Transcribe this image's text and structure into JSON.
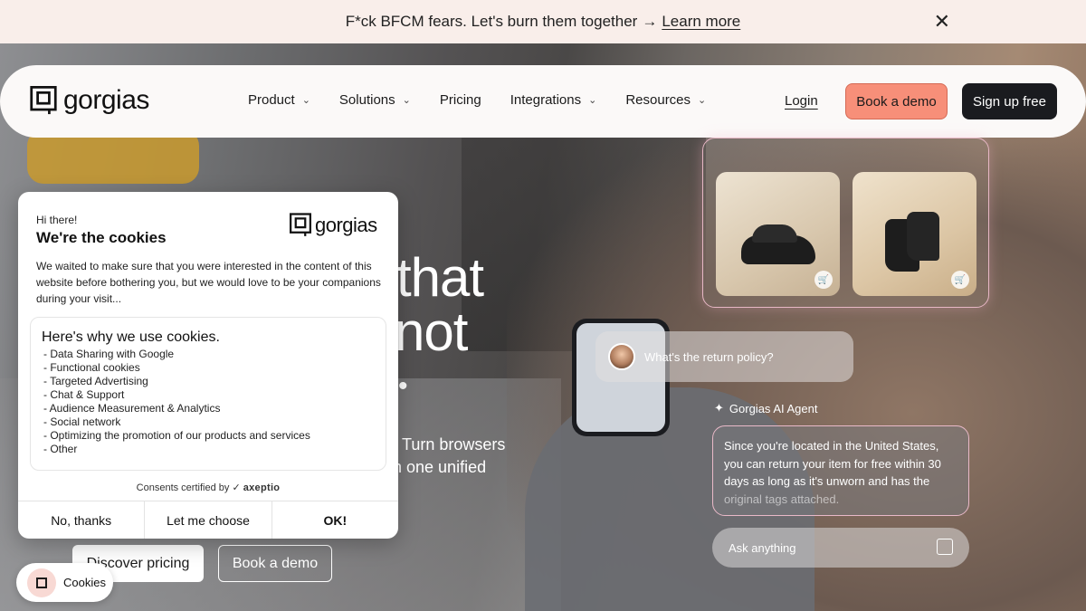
{
  "announcement": {
    "text": "F*ck BFCM fears. Let's burn them together",
    "arrow": "→",
    "link": "Learn more",
    "close": "✕"
  },
  "nav": {
    "brand": "gorgias",
    "menu": [
      {
        "label": "Product",
        "chevron": "⌄"
      },
      {
        "label": "Solutions",
        "chevron": "⌄"
      },
      {
        "label": "Pricing"
      },
      {
        "label": "Integrations",
        "chevron": "⌄"
      },
      {
        "label": "Resources",
        "chevron": "⌄"
      }
    ],
    "login": "Login",
    "book_demo": "Book a demo",
    "signup": "Sign up free"
  },
  "hero": {
    "headline_line1": "that",
    "headline_line2": "not",
    "dot": "•",
    "subtext_line1": "Turn browsers",
    "subtext_line2": "n one unified",
    "discover_pricing": "Discover pricing",
    "book_demo": "Book a demo"
  },
  "chat": {
    "question": "What's the return policy?",
    "agent_label": "Gorgias AI Agent",
    "answer": "Since you're located in the United States, you can return your item for free within 30 days as long as it's unworn and has the",
    "answer_fade": "original tags attached.",
    "ask_placeholder": "Ask anything"
  },
  "cookie_dialog": {
    "greeting": "Hi there!",
    "title": "We're the cookies",
    "brand": "gorgias",
    "intro": "We waited to make sure that you were interested in the content of this website before bothering you, but we would love to be your companions during your visit...",
    "why_title": "Here's why we use cookies.",
    "reasons": [
      "Data Sharing with Google",
      "Functional cookies",
      "Targeted Advertising",
      "Chat & Support",
      "Audience Measurement & Analytics",
      "Social network",
      "Optimizing the promotion of our products and services",
      "Other"
    ],
    "certified": "Consents certified by",
    "certifier": "axeptio",
    "no_thanks": "No, thanks",
    "let_me_choose": "Let me choose",
    "ok": "OK!"
  },
  "cookie_pill": {
    "label": "Cookies"
  },
  "colors": {
    "accent": "#f78f79",
    "dark": "#1a1b1f",
    "announcement_bg": "#f9eeea"
  }
}
